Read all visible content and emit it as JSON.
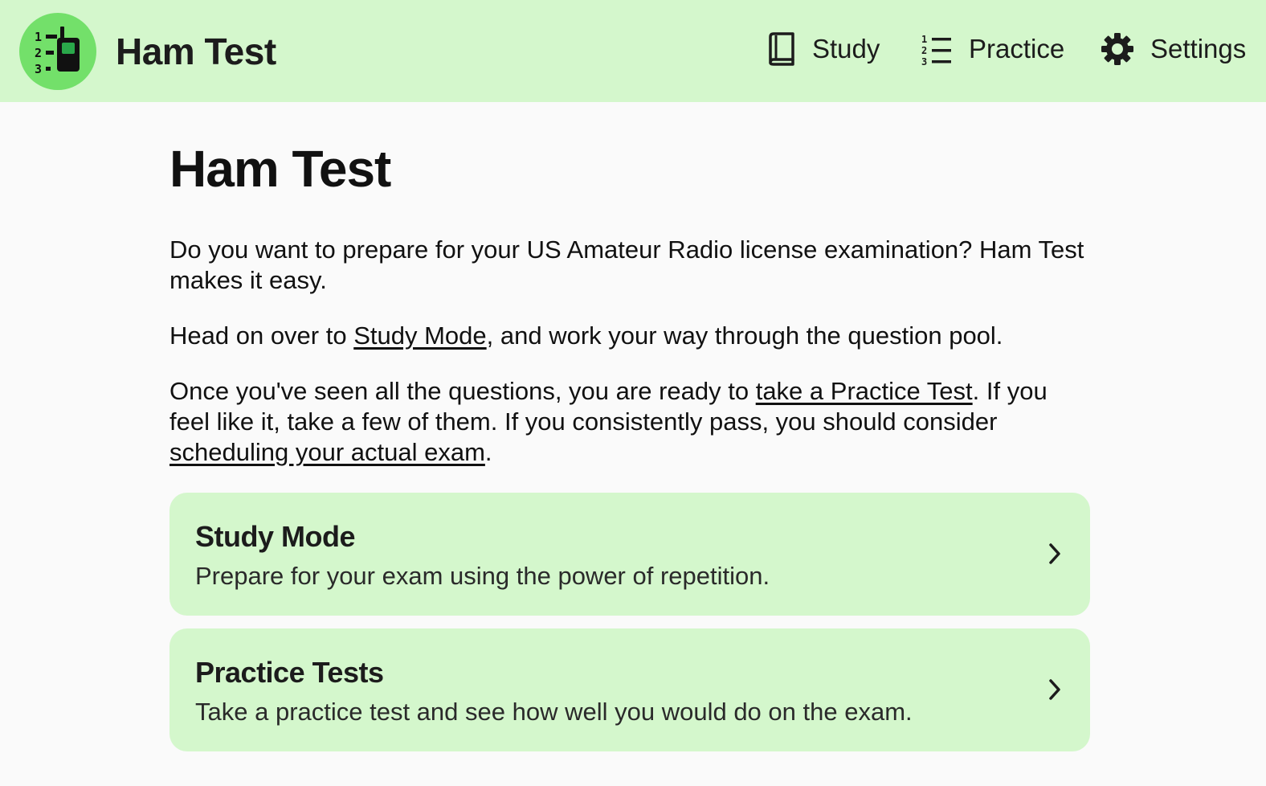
{
  "header": {
    "app_title": "Ham Test",
    "logo_icon": "radio-checklist-icon",
    "nav": [
      {
        "label": "Study",
        "icon": "book-icon"
      },
      {
        "label": "Practice",
        "icon": "numbered-list-icon"
      },
      {
        "label": "Settings",
        "icon": "gear-icon"
      }
    ]
  },
  "main": {
    "title": "Ham Test",
    "intro": "Do you want to prepare for your US Amateur Radio license examination? Ham Test makes it easy.",
    "study_para": {
      "before": "Head on over to ",
      "link": "Study Mode",
      "after": ", and work your way through the question pool."
    },
    "practice_para": {
      "before": "Once you've seen all the questions, you are ready to ",
      "link1": "take a Practice Test",
      "middle": ". If you feel like it, take a few of them. If you consistently pass, you should consider ",
      "link2": "scheduling your actual exam",
      "after": "."
    },
    "cards": [
      {
        "title": "Study Mode",
        "description": "Prepare for your exam using the power of repetition."
      },
      {
        "title": "Practice Tests",
        "description": "Take a practice test and see how well you would do on the exam."
      }
    ]
  },
  "colors": {
    "header_bg": "#d4f7cc",
    "logo_bg": "#73e06a",
    "card_bg": "#d4f7cc",
    "page_bg": "#fafafa"
  }
}
